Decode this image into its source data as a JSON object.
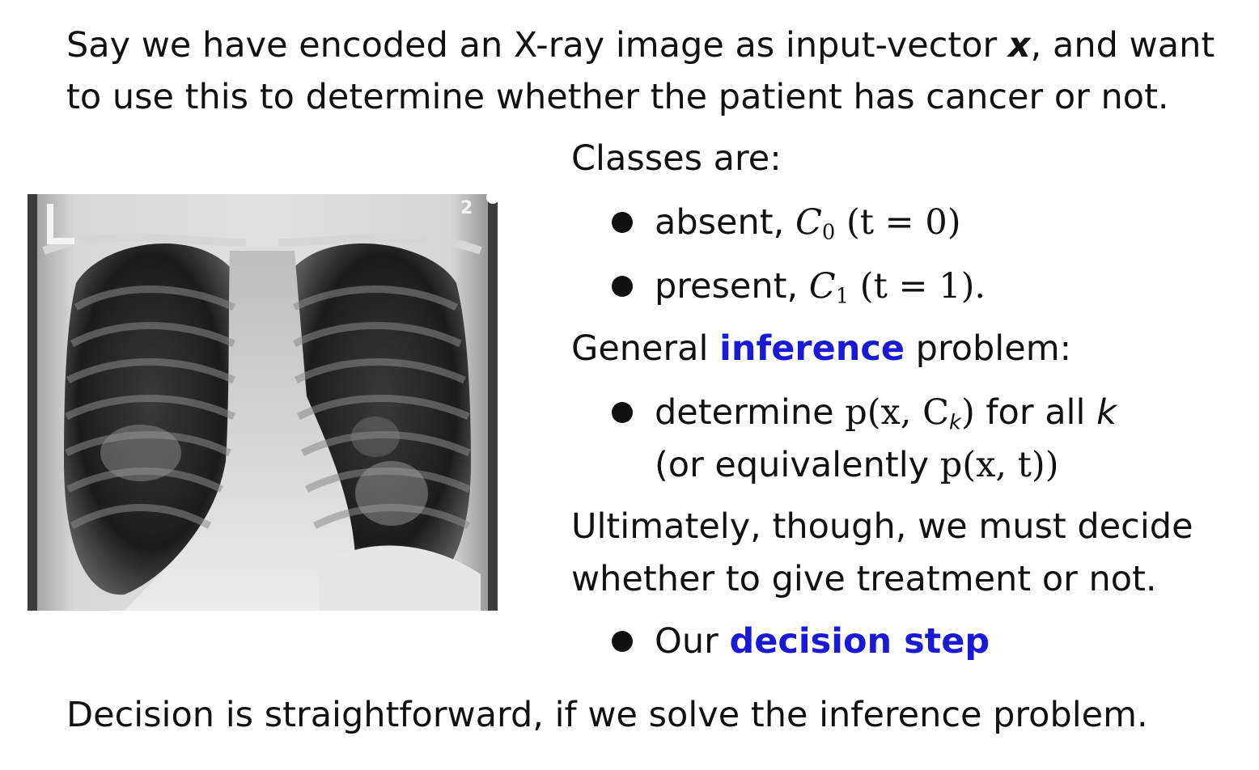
{
  "intro": {
    "line1_before": "Say we have encoded an X-ray image as input-vector ",
    "line1_var": "x",
    "line1_after": ", and want",
    "line2": "to use this to determine whether the patient has cancer or not."
  },
  "classes": {
    "heading": "Classes are:",
    "items": [
      {
        "label": "absent, ",
        "symbol": "C",
        "sub": "0",
        "cond": " (t = 0)"
      },
      {
        "label": "present, ",
        "symbol": "C",
        "sub": "1",
        "cond": " (t = 1)."
      }
    ]
  },
  "inference": {
    "prefix": "General ",
    "keyword": "inference",
    "suffix": " problem:",
    "bullet_line1_prefix": "determine ",
    "bullet_line1_math": "p(x, C",
    "bullet_line1_sub": "k",
    "bullet_line1_close": ")",
    "bullet_line1_suffix": " for all ",
    "bullet_line1_var": "k",
    "bullet_line2_prefix": "(or equivalently ",
    "bullet_line2_math": "p(x, t))"
  },
  "decision": {
    "line1": "Ultimately, though, we must decide",
    "line2": "whether to give treatment or not.",
    "bullet_prefix": "Our ",
    "bullet_keyword": "decision step"
  },
  "closing": "Decision is straightforward, if we solve the inference problem.",
  "image": {
    "marker_left": "L",
    "marker_right": "2"
  },
  "colors": {
    "accent": "#1a1ad6",
    "text": "#111111"
  }
}
